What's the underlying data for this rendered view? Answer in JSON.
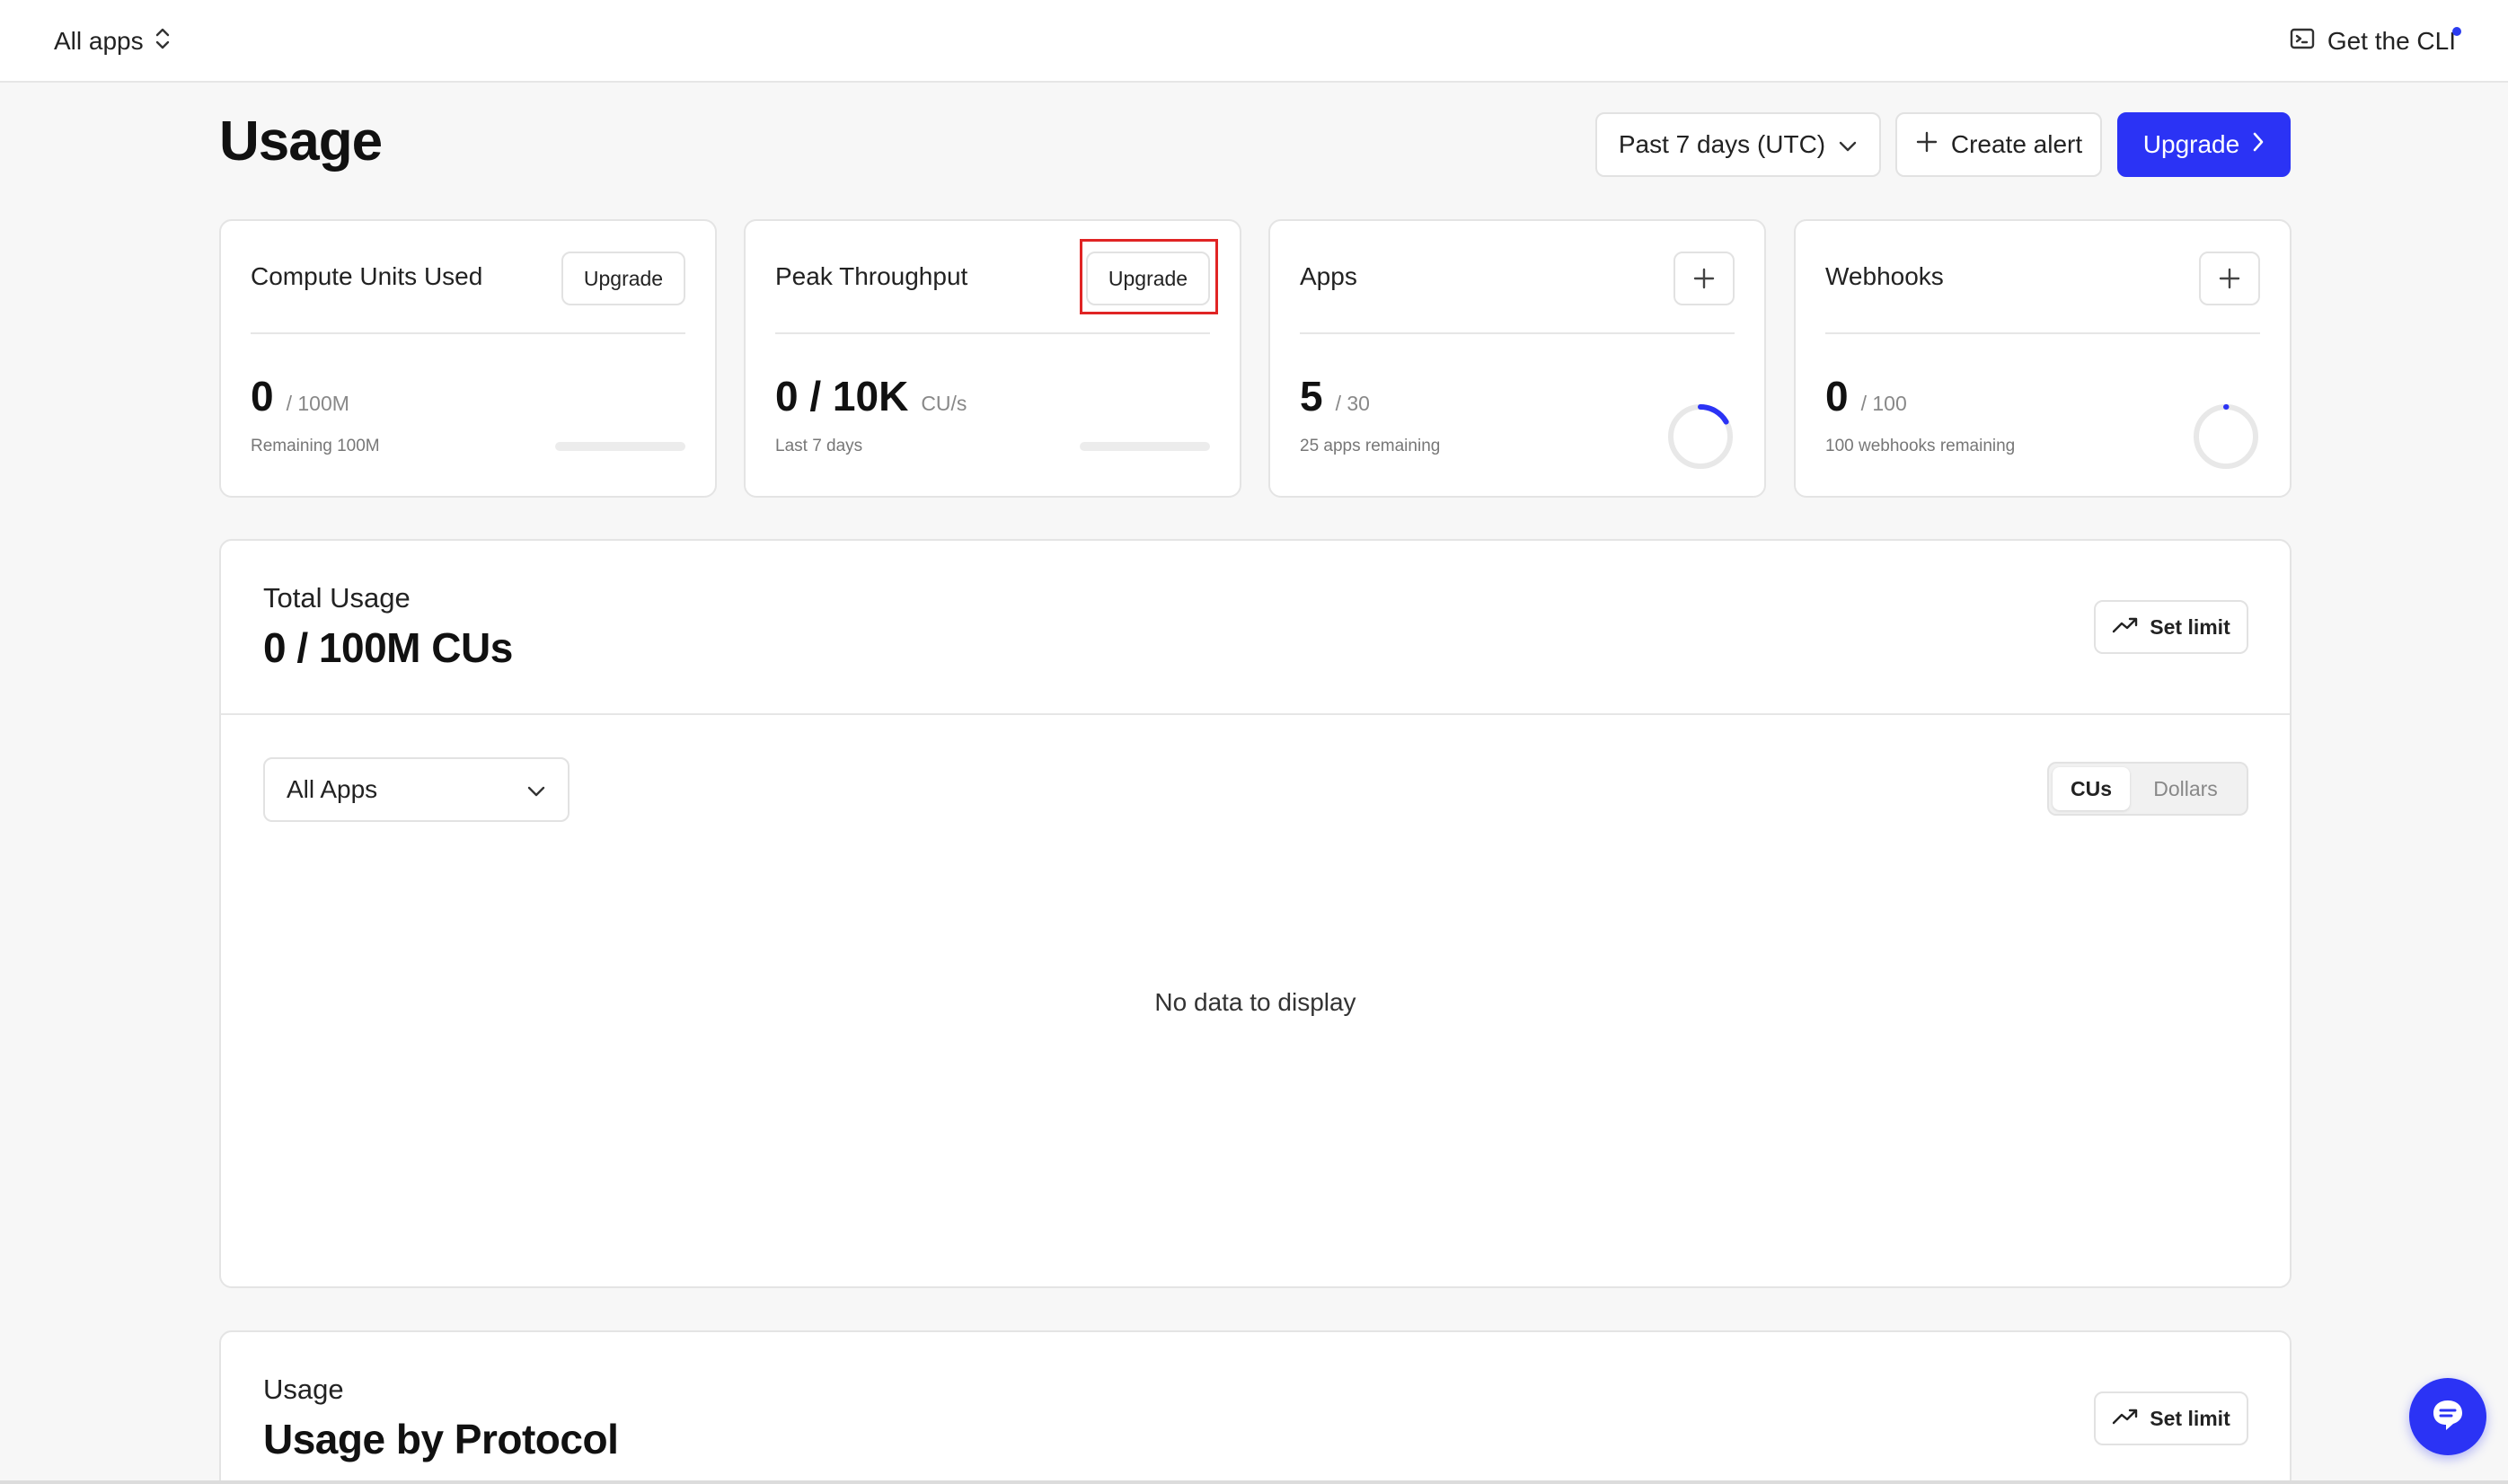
{
  "topbar": {
    "app_switcher_label": "All apps",
    "cli_label": "Get the CLI"
  },
  "header": {
    "title": "Usage",
    "time_range": "Past 7 days (UTC)",
    "create_alert": "Create alert",
    "upgrade": "Upgrade"
  },
  "cards": [
    {
      "title": "Compute Units Used",
      "action": "Upgrade",
      "value": "0",
      "limit": "/ 100M",
      "subtitle": "Remaining 100M",
      "progress": 0
    },
    {
      "title": "Peak Throughput",
      "action": "Upgrade",
      "value": "0 / 10K",
      "limit": "CU/s",
      "subtitle": "Last 7 days",
      "progress": 0
    },
    {
      "title": "Apps",
      "action": "+",
      "value": "5",
      "limit": "/ 30",
      "subtitle": "25 apps remaining",
      "progress": 0.1667
    },
    {
      "title": "Webhooks",
      "action": "+",
      "value": "0",
      "limit": "/ 100",
      "subtitle": "100 webhooks remaining",
      "progress": 0
    }
  ],
  "total_usage": {
    "label": "Total Usage",
    "value": "0 / 100M CUs",
    "set_limit": "Set limit",
    "app_filter": "All Apps",
    "unit_options": [
      "CUs",
      "Dollars"
    ],
    "selected_unit": "CUs",
    "empty_message": "No data to display"
  },
  "protocol_usage": {
    "label": "Usage",
    "heading": "Usage by Protocol",
    "set_limit": "Set limit"
  },
  "colors": {
    "accent": "#2b33f5",
    "highlight": "#e02424",
    "ring_track": "#e8e8e8"
  },
  "icons": {
    "app_switcher": "chevron-up-down-icon",
    "cli": "terminal-icon",
    "dropdown": "chevron-down-icon",
    "create_alert": "plus-icon",
    "upgrade": "chevron-right-icon",
    "set_limit": "trending-up-icon",
    "chat": "chat-bubble-icon"
  }
}
